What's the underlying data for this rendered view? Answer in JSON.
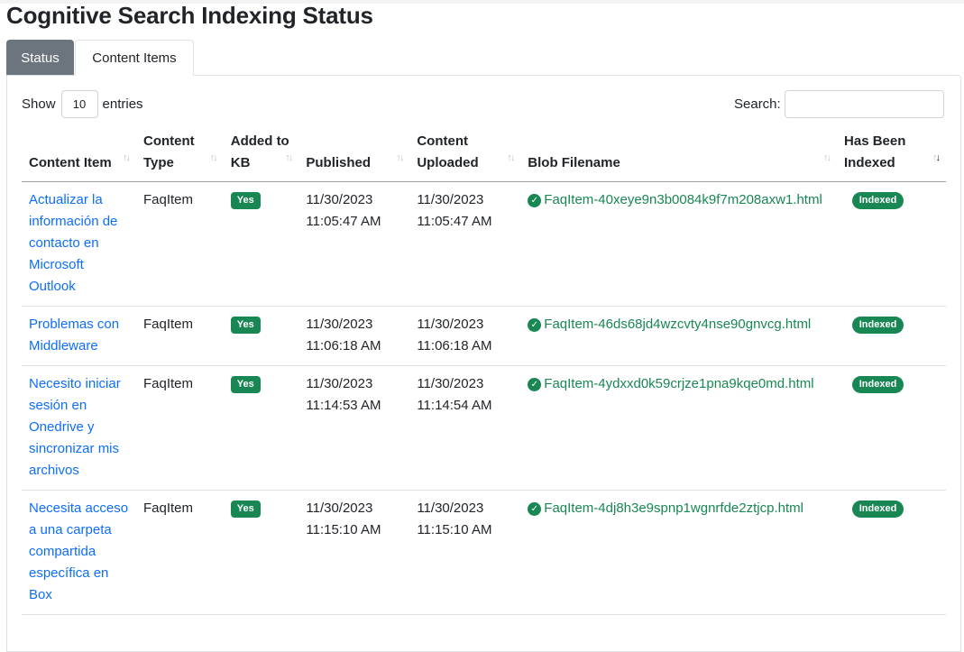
{
  "page_title": "Cognitive Search Indexing Status",
  "tabs": [
    {
      "label": "Status",
      "active": false
    },
    {
      "label": "Content Items",
      "active": true
    }
  ],
  "length_menu": {
    "prefix": "Show",
    "value": "10",
    "suffix": "entries"
  },
  "search": {
    "label": "Search:",
    "value": ""
  },
  "columns": {
    "content_item": "Content Item",
    "content_type": "Content Type",
    "added_to_kb": "Added to KB",
    "published": "Published",
    "content_uploaded": "Content Uploaded",
    "blob_filename": "Blob Filename",
    "has_been_indexed": "Has Been Indexed"
  },
  "sorted_column": "has_been_indexed",
  "sort_direction": "descending",
  "colors": {
    "link": "#0d6efd",
    "success": "#198754",
    "tab_active_bg": "#6c757d"
  },
  "rows": [
    {
      "content_item": "Actualizar la información de contacto en Microsoft Outlook",
      "content_type": "FaqItem",
      "added_to_kb": "Yes",
      "published_date": "11/30/2023",
      "published_time": "11:05:47 AM",
      "uploaded_date": "11/30/2023",
      "uploaded_time": "11:05:47 AM",
      "blob_filename": "FaqItem-40xeye9n3b0084k9f7m208axw1.html",
      "indexed": "Indexed"
    },
    {
      "content_item": "Problemas con Middleware",
      "content_type": "FaqItem",
      "added_to_kb": "Yes",
      "published_date": "11/30/2023",
      "published_time": "11:06:18 AM",
      "uploaded_date": "11/30/2023",
      "uploaded_time": "11:06:18 AM",
      "blob_filename": "FaqItem-46ds68jd4wzcvty4nse90gnvcg.html",
      "indexed": "Indexed"
    },
    {
      "content_item": "Necesito iniciar sesión en Onedrive y sincronizar mis archivos",
      "content_type": "FaqItem",
      "added_to_kb": "Yes",
      "published_date": "11/30/2023",
      "published_time": "11:14:53 AM",
      "uploaded_date": "11/30/2023",
      "uploaded_time": "11:14:54 AM",
      "blob_filename": "FaqItem-4ydxxd0k59crjze1pna9kqe0md.html",
      "indexed": "Indexed"
    },
    {
      "content_item": "Necesita acceso a una carpeta compartida específica en Box",
      "content_type": "FaqItem",
      "added_to_kb": "Yes",
      "published_date": "11/30/2023",
      "published_time": "11:15:10 AM",
      "uploaded_date": "11/30/2023",
      "uploaded_time": "11:15:10 AM",
      "blob_filename": "FaqItem-4dj8h3e9spnp1wgnrfde2ztjcp.html",
      "indexed": "Indexed"
    }
  ]
}
